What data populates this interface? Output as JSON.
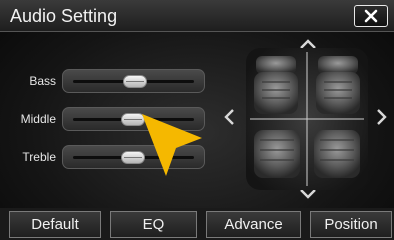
{
  "window": {
    "title": "Audio Setting"
  },
  "sliders": [
    {
      "label": "Bass",
      "value": 0.5
    },
    {
      "label": "Middle",
      "value": 0.49
    },
    {
      "label": "Treble",
      "value": 0.49
    }
  ],
  "balance": {
    "front_rear": 0.5,
    "left_right": 0.5
  },
  "buttons": {
    "default_label": "Default",
    "eq_label": "EQ",
    "advance_label": "Advance",
    "position_label": "Position"
  },
  "colors": {
    "accent_pointer": "#f5b800",
    "arrow": "#d8d8d8"
  }
}
